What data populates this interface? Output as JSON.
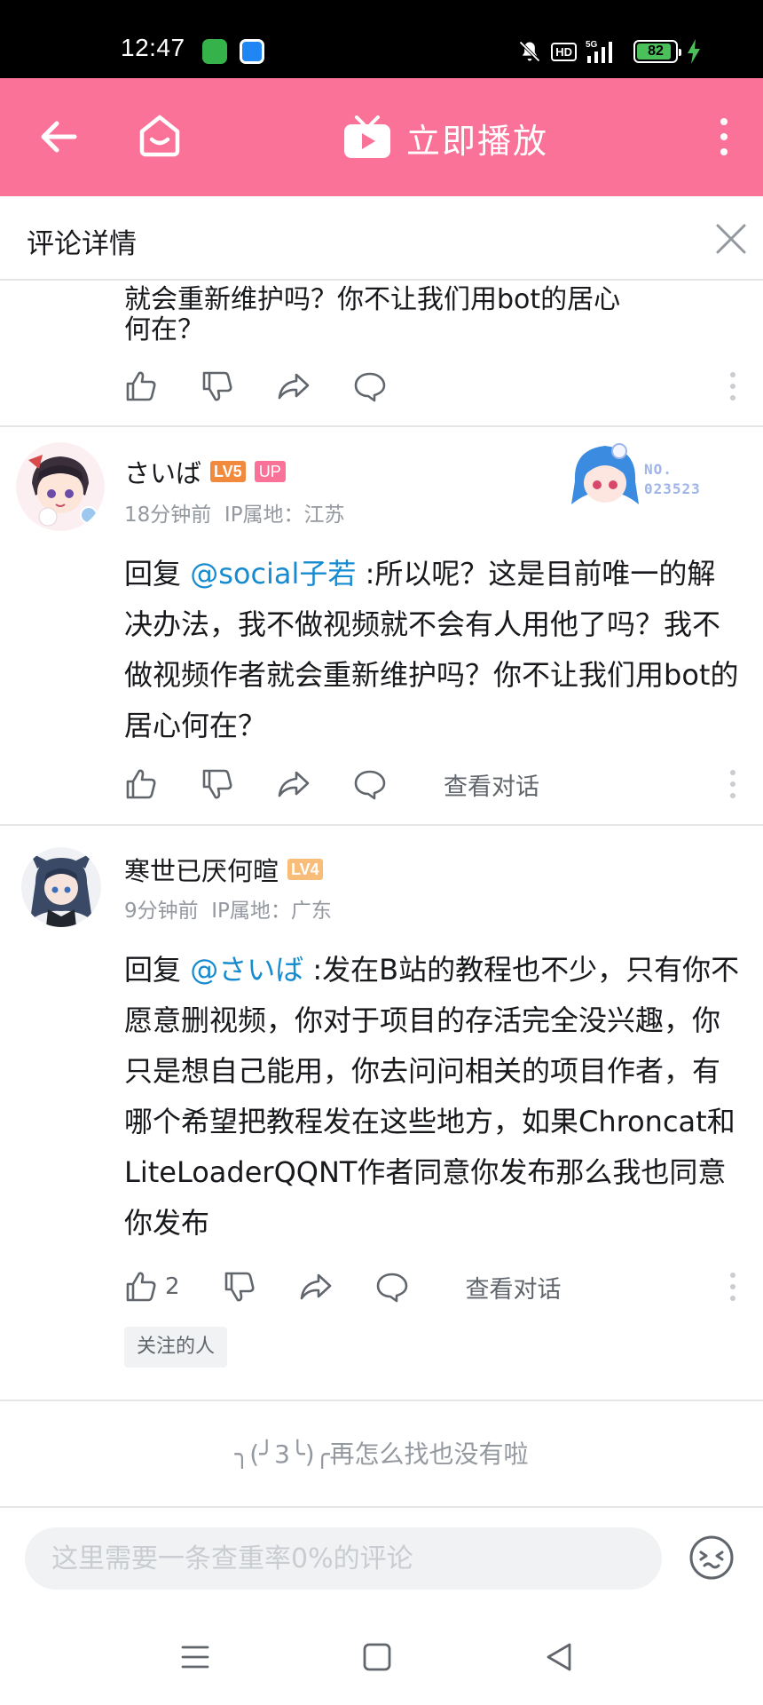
{
  "status_bar": {
    "time": "12:47",
    "hd": "HD",
    "network": "5G",
    "battery": "82"
  },
  "header": {
    "play_label": "立即播放"
  },
  "titlebar": {
    "title": "评论详情"
  },
  "previous_comment": {
    "cut_line": "就会重新维护吗？你不让我们用bot的居心",
    "tail": "何在？"
  },
  "comments": [
    {
      "username": "さいば",
      "level": "LV5",
      "up_badge": "UP",
      "time": "18分钟前",
      "ip": "IP属地：江苏",
      "fan_badge_label": "NO.",
      "fan_badge_number": "023523",
      "reply_prefix": "回复 ",
      "mention": "@social子若",
      "text": " :所以呢？这是目前唯一的解决办法，我不做视频就不会有人用他了吗？我不做视频作者就会重新维护吗？你不让我们用bot的居心何在？",
      "view_dialog": "查看对话"
    },
    {
      "username": "寒世已厌何暄",
      "level": "LV4",
      "time": "9分钟前",
      "ip": "IP属地：广东",
      "reply_prefix": "回复 ",
      "mention": "@さいば",
      "text": " :发在B站的教程也不少，只有你不愿意删视频，你对于项目的存活完全没兴趣，你只是想自己能用，你去问问相关的项目作者，有哪个希望把教程发在这些地方，如果Chroncat和LiteLoaderQQNT作者同意你发布那么我也同意你发布",
      "like_count": "2",
      "view_dialog": "查看对话",
      "tag": "关注的人"
    }
  ],
  "end_message": "╮(╯3╰)╭再怎么找也没有啦",
  "input": {
    "placeholder": "这里需要一条查重率0%的评论"
  },
  "colors": {
    "brand_pink": "#fb7299",
    "mention_blue": "#178bcf",
    "level5": "#f28a3e",
    "level4": "#f7bd79"
  },
  "icons": [
    "back-icon",
    "home-icon",
    "tv-play-icon",
    "more-icon",
    "close-icon",
    "like-icon",
    "dislike-icon",
    "share-icon",
    "reply-icon",
    "emoji-icon",
    "menu-nav-icon",
    "home-nav-icon",
    "back-nav-icon"
  ]
}
